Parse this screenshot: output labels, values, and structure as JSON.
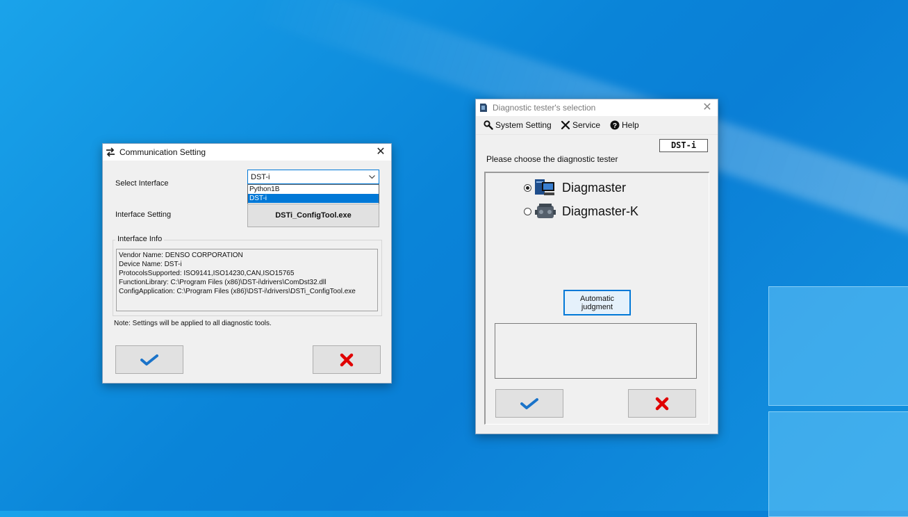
{
  "comm_window": {
    "title": "Communication Setting",
    "select_interface_label": "Select Interface",
    "select_interface_value": "DST-i",
    "dropdown_options": [
      "Python1B",
      "DST-i"
    ],
    "selected_option_index": 1,
    "interface_setting_label": "Interface Setting",
    "config_tool_button": "DSTi_ConfigTool.exe",
    "interface_info": {
      "title": "Interface Info",
      "lines": [
        "Vendor Name: DENSO CORPORATION",
        "Device Name: DST-i",
        "ProtocolsSupported: ISO9141,ISO14230,CAN,ISO15765",
        "FunctionLibrary: C:\\Program Files (x86)\\DST-i\\drivers\\ComDst32.dll",
        "ConfigApplication: C:\\Program Files (x86)\\DST-i\\drivers\\DSTi_ConfigTool.exe"
      ]
    },
    "note": "Note: Settings will be applied to all diagnostic tools."
  },
  "diag_window": {
    "title": "Diagnostic tester's selection",
    "menu": [
      "System Setting",
      "Service",
      "Help"
    ],
    "device_badge": "DST-i",
    "prompt": "Please choose the diagnostic tester",
    "testers": [
      {
        "name": "Diagmaster",
        "selected": true
      },
      {
        "name": "Diagmaster-K",
        "selected": false
      }
    ],
    "auto_button_line1": "Automatic",
    "auto_button_line2": "judgment"
  },
  "colors": {
    "check": "#1a73c9",
    "cross": "#e00000",
    "accent": "#0078d7"
  }
}
